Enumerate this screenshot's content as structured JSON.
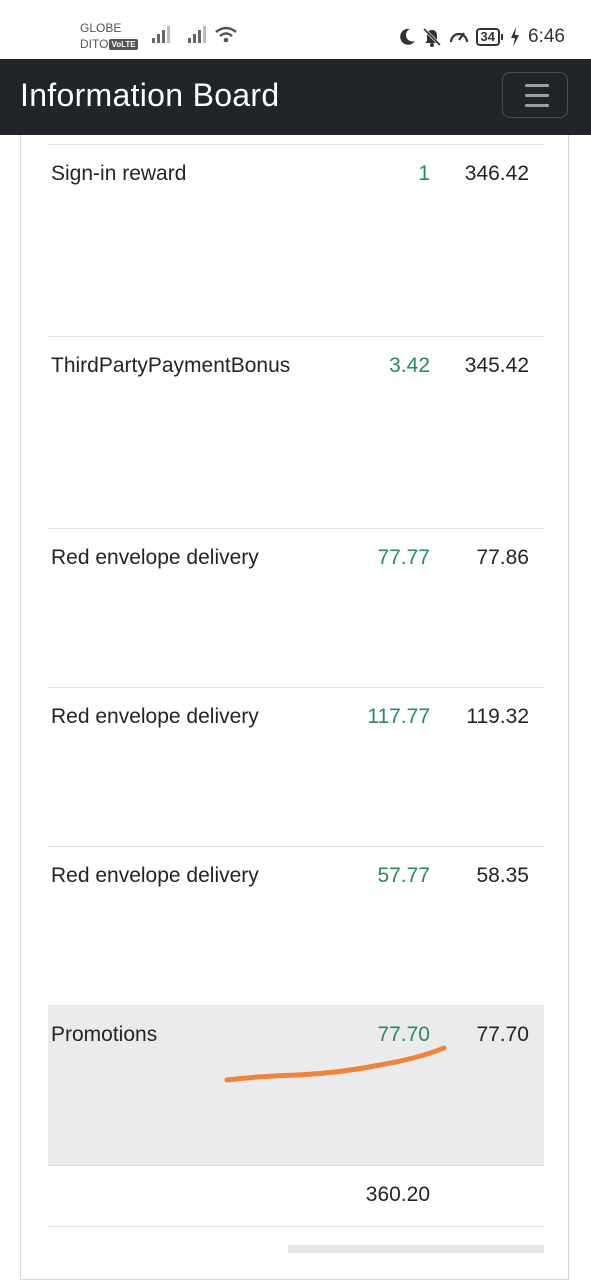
{
  "status_bar": {
    "carrier_1": "GLOBE",
    "carrier_2": "DITO",
    "volte_badge": "VoLTE",
    "battery": "34",
    "time": "6:46"
  },
  "navbar": {
    "title": "Information Board",
    "menu_icon": "hamburger-menu-icon"
  },
  "table": {
    "rows": [
      {
        "name": "Sign-in reward",
        "amount": "1",
        "balance": "346.42"
      },
      {
        "name": "ThirdPartyPaymentBonus",
        "amount": "3.42",
        "balance": "345.42"
      },
      {
        "name": "Red envelope delivery",
        "amount": "77.77",
        "balance": "77.86"
      },
      {
        "name": "Red envelope delivery",
        "amount": "117.77",
        "balance": "119.32"
      },
      {
        "name": "Red envelope delivery",
        "amount": "57.77",
        "balance": "58.35"
      },
      {
        "name": "Promotions",
        "amount": "77.70",
        "balance": "77.70"
      }
    ],
    "total": "360.20"
  },
  "colors": {
    "navbar_bg": "#212529",
    "amount_green": "#2a8a5f",
    "highlight_row": "#ebebeb",
    "annotation_stroke": "#f0843c"
  }
}
